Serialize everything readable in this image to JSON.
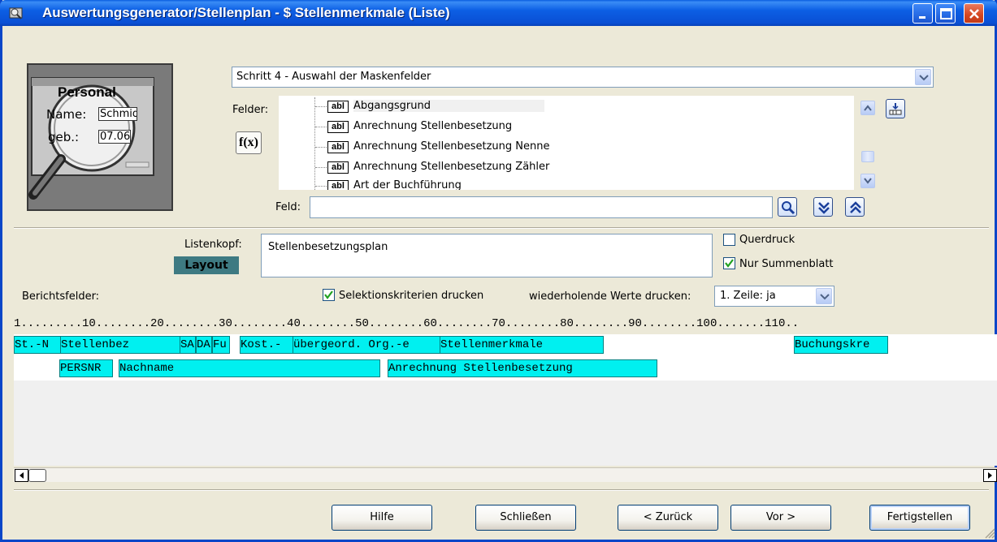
{
  "window": {
    "title": "Auswertungsgenerator/Stellenplan  -  $ Stellenmerkmale (Liste)"
  },
  "logo": {
    "personal": "Personal",
    "name_label": "Name:",
    "name_value": "Schmid",
    "geb_label": "geb.:",
    "geb_value": "07.06"
  },
  "step": {
    "selected": "Schritt 4  -  Auswahl der Maskenfelder"
  },
  "fields": {
    "label": "Felder:",
    "fx_label": "f(x)",
    "items": [
      {
        "icon": "abl",
        "label": "Abgangsgrund"
      },
      {
        "icon": "abl",
        "label": "Anrechnung Stellenbesetzung"
      },
      {
        "icon": "abl",
        "label": "Anrechnung Stellenbesetzung Nenne"
      },
      {
        "icon": "abl",
        "label": "Anrechnung Stellenbesetzung Zähler"
      },
      {
        "icon": "abl",
        "label": "Art der Buchführung"
      }
    ]
  },
  "feld": {
    "label": "Feld:",
    "value": ""
  },
  "listenkopf": {
    "label": "Listenkopf:",
    "layout_label": "Layout",
    "value": "Stellenbesetzungsplan"
  },
  "options": {
    "querdruck": {
      "label": "Querdruck",
      "checked": false
    },
    "nur_summenblatt": {
      "label": "Nur Summenblatt",
      "checked": true
    },
    "selektionskriterien": {
      "label": "Selektionskriterien drucken",
      "checked": true
    },
    "wiederholende_label": "wiederholende Werte drucken:",
    "wiederholende_value": "1. Zeile: ja"
  },
  "berichtsfelder_label": "Berichtsfelder:",
  "ruler": "1.........10........20........30........40........50........60........70........80........90........100.......110..",
  "report_fields": {
    "row1": [
      "St.-N",
      "Stellenbez",
      "SA",
      "DA",
      "Fu",
      "Kost.-",
      "übergeord. Org.-e",
      "Stellenmerkmale",
      "Buchungskre"
    ],
    "row2": [
      "PERSNR",
      "Nachname",
      "Anrechnung Stellenbesetzung"
    ]
  },
  "buttons": {
    "hilfe": "Hilfe",
    "schliessen": "Schließen",
    "zurueck": "< Zurück",
    "vor": "Vor >",
    "fertigstellen": "Fertigstellen"
  }
}
